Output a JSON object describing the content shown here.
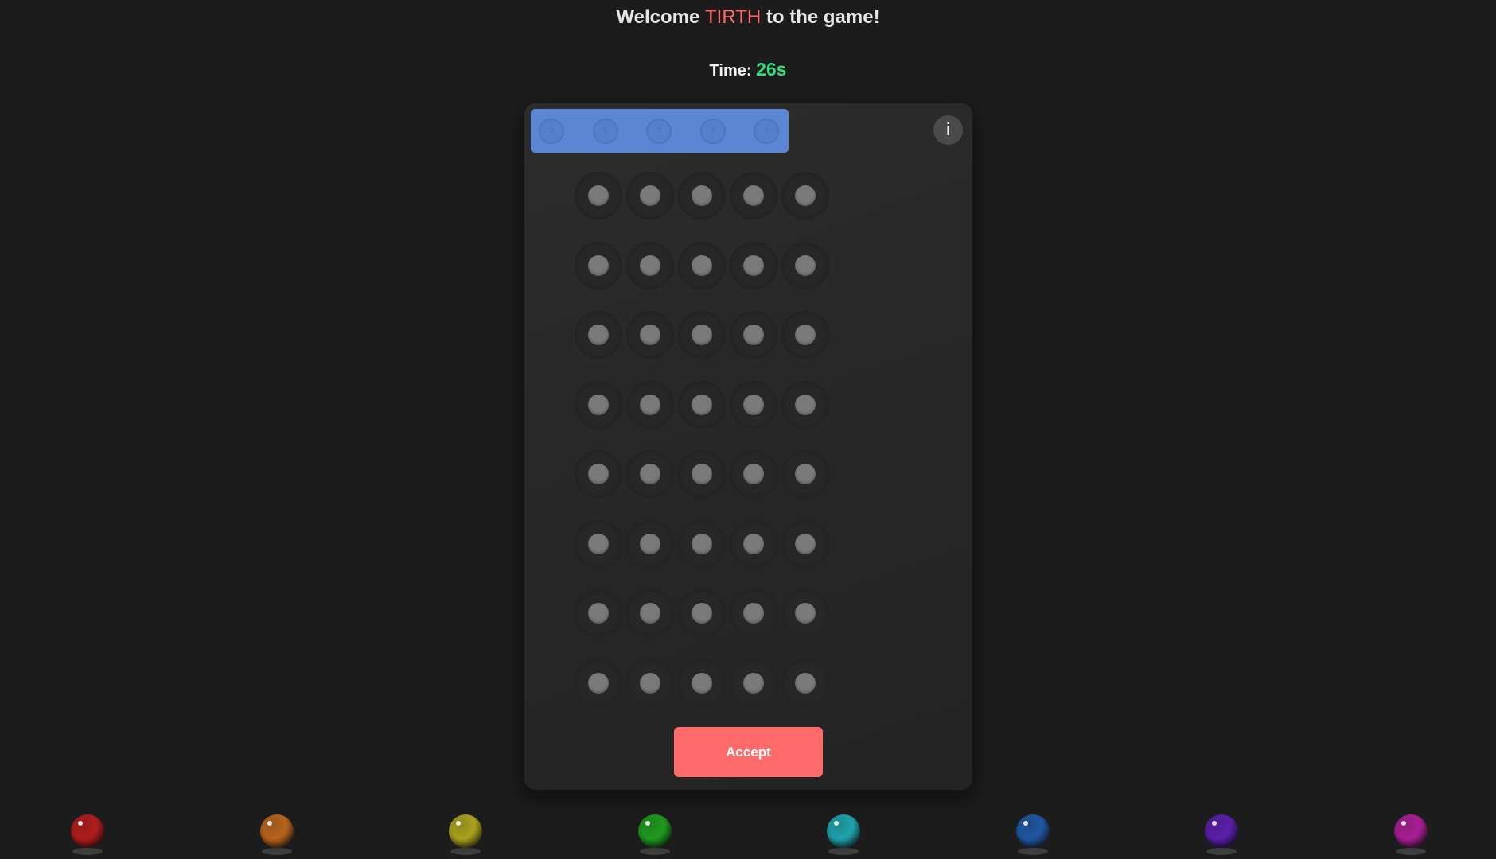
{
  "header": {
    "welcome_prefix": "Welcome",
    "player_name": "TIRTH",
    "welcome_suffix": "to the game!"
  },
  "timer": {
    "label": "Time:",
    "value": "26s"
  },
  "secret": {
    "slot_symbol": "?",
    "slots": 5,
    "bar_color": "#5b86d4"
  },
  "info": {
    "label": "i"
  },
  "board": {
    "rows": 8,
    "pegs_per_row": 5,
    "empty_peg_color": "#7a7a7a"
  },
  "accept_button": {
    "label": "Accept",
    "color": "#ff6b6b"
  },
  "palette": {
    "colors": [
      {
        "name": "red",
        "hex": "#b01c1c"
      },
      {
        "name": "orange",
        "hex": "#b8641c"
      },
      {
        "name": "yellow",
        "hex": "#aaa21c"
      },
      {
        "name": "green",
        "hex": "#1e9a1e"
      },
      {
        "name": "cyan",
        "hex": "#1ea2ac"
      },
      {
        "name": "blue",
        "hex": "#1e56a2"
      },
      {
        "name": "purple",
        "hex": "#5a1eaa"
      },
      {
        "name": "magenta",
        "hex": "#a81e94"
      }
    ]
  },
  "colors": {
    "background": "#1c1c1c",
    "player_name": "#ff6b6b",
    "timer_value": "#2ee07a"
  }
}
